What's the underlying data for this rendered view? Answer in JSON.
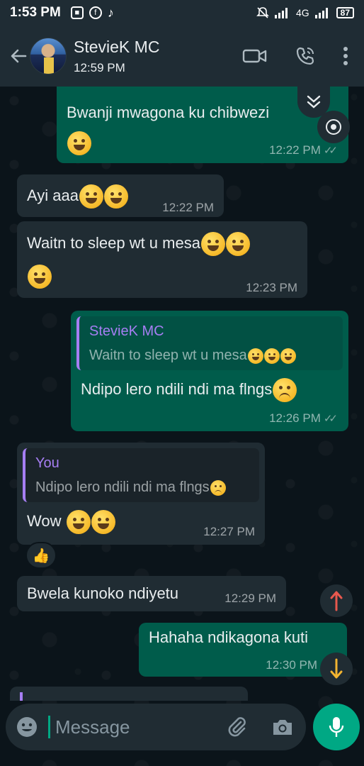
{
  "status_bar": {
    "time": "1:53 PM",
    "battery": "87",
    "network": "4G"
  },
  "header": {
    "contact_name": "StevieK MC",
    "last_seen": "12:59 PM"
  },
  "messages": [
    {
      "id": "m1",
      "direction": "outgoing",
      "text": "Bwanji mwagona ku chibwezi",
      "time": "12:22 PM",
      "status": "read"
    },
    {
      "id": "m2",
      "direction": "incoming",
      "text": "Ayi aaa",
      "time": "12:22 PM"
    },
    {
      "id": "m3",
      "direction": "incoming",
      "text": "Waitn to sleep  wt u mesa",
      "time": "12:23 PM"
    },
    {
      "id": "m4",
      "direction": "outgoing",
      "quote_name": "StevieK MC",
      "quote_text": "Waitn to sleep  wt u mesa",
      "text": "Ndipo lero ndili ndi ma flngs",
      "time": "12:26 PM",
      "status": "read"
    },
    {
      "id": "m5",
      "direction": "incoming",
      "quote_name": "You",
      "quote_text": "Ndipo lero ndili ndi ma flngs",
      "text": "Wow",
      "time": "12:27 PM",
      "reaction": "👍"
    },
    {
      "id": "m6",
      "direction": "incoming",
      "text": "Bwela kunoko ndiyetu",
      "time": "12:29 PM"
    },
    {
      "id": "m7",
      "direction": "outgoing",
      "text": "Hahaha ndikagona kuti",
      "time": "12:30 PM"
    }
  ],
  "composer": {
    "placeholder": "Message"
  },
  "icons": {
    "back": "back-arrow-icon",
    "video": "video-call-icon",
    "voice": "voice-call-icon",
    "menu": "more-vert-icon",
    "emoji": "emoji-icon",
    "attach": "attach-icon",
    "camera": "camera-icon",
    "mic": "mic-icon"
  },
  "colors": {
    "outgoing_bubble": "#005c4b",
    "incoming_bubble": "#202c33",
    "accent": "#00a884",
    "quote_accent": "#a67ef3"
  }
}
